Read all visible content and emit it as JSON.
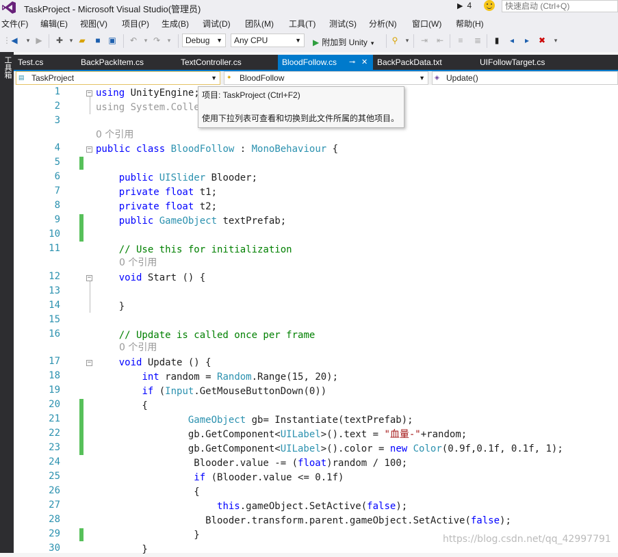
{
  "window": {
    "title": "TaskProject - Microsoft Visual Studio(管理员)",
    "notifications_count": "4",
    "quick_launch_placeholder": "快速启动 (Ctrl+Q)"
  },
  "menu": [
    "文件(F)",
    "编辑(E)",
    "视图(V)",
    "项目(P)",
    "生成(B)",
    "调试(D)",
    "团队(M)",
    "工具(T)",
    "测试(S)",
    "分析(N)",
    "窗口(W)",
    "帮助(H)"
  ],
  "toolbar": {
    "config": "Debug",
    "platform": "Any CPU",
    "attach_label": "附加到 Unity"
  },
  "left_strip_label": "工具箱",
  "tabs": [
    {
      "label": "Test.cs",
      "active": false
    },
    {
      "label": "BackPackItem.cs",
      "active": false
    },
    {
      "label": "TextController.cs",
      "active": false
    },
    {
      "label": "BloodFollow.cs",
      "active": true
    },
    {
      "label": "BackPackData.txt",
      "active": false
    },
    {
      "label": "UIFollowTarget.cs",
      "active": false
    }
  ],
  "navbar": {
    "project": "TaskProject",
    "class": "BloodFollow",
    "member": "Update()"
  },
  "tooltip": {
    "line1": "项目: TaskProject (Ctrl+F2)",
    "line2": "使用下拉列表可查看和切换到此文件所属的其他项目。"
  },
  "code": {
    "refs": [
      "0 个引用",
      "0 个引用",
      "0 个引用"
    ],
    "line_numbers": [
      "1",
      "2",
      "3",
      "4",
      "5",
      "6",
      "7",
      "8",
      "9",
      "10",
      "11",
      "12",
      "13",
      "14",
      "15",
      "16",
      "17",
      "18",
      "19",
      "20",
      "21",
      "22",
      "23",
      "24",
      "25",
      "26",
      "27",
      "28",
      "29",
      "30"
    ]
  },
  "watermark": "https://blog.csdn.net/qq_42997791",
  "colors": {
    "accent": "#007acc",
    "keyword": "#0000ff",
    "type": "#2b91af",
    "comment": "#008000",
    "string": "#a31515",
    "change_marker": "#57c05a"
  }
}
